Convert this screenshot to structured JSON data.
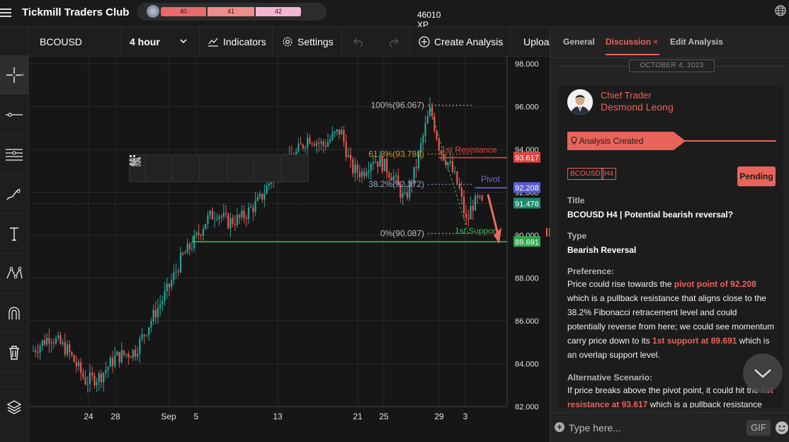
{
  "app": {
    "title": "Tickmill Traders Club",
    "xp_segments": [
      "40",
      "41",
      "42"
    ],
    "xp_value": "46010 XP"
  },
  "chart_header": {
    "symbol": "BCOUSD",
    "interval": "4 hour",
    "indicators_label": "Indicators",
    "settings_label": "Settings",
    "create_label": "Create Analysis",
    "upload_label": "Upload"
  },
  "chart_data": {
    "type": "candlestick",
    "symbol": "BCOUSD",
    "y_ticks": [
      "98.000",
      "96.000",
      "94.000",
      "92.000",
      "90.000",
      "88.000",
      "86.000",
      "84.000",
      "82.000"
    ],
    "ylim": [
      82.0,
      98.0
    ],
    "x_ticks": [
      "24",
      "28",
      "Sep",
      "5",
      "13",
      "21",
      "25",
      "29",
      "3"
    ],
    "fib_levels": [
      {
        "label": "100%(96.067)",
        "value": 96.067
      },
      {
        "label": "61.8%(93.788)",
        "value": 93.788
      },
      {
        "label": "38.2%(92.372)",
        "value": 92.372
      },
      {
        "label": "0%(90.087)",
        "value": 90.087
      }
    ],
    "lines": [
      {
        "label": "1st Resistance",
        "value": 93.617,
        "color": "#e0443f"
      },
      {
        "label": "Pivot",
        "value": 92.208,
        "color": "#6a6ae6"
      },
      {
        "label": "1st Support",
        "value": 89.691,
        "color": "#3dbb4e"
      }
    ],
    "price_badges": [
      {
        "text": "93.617",
        "color": "#e0443f"
      },
      {
        "text": "92.208",
        "color": "#5a5ad6"
      },
      {
        "text": "91.476",
        "color": "#1f8a70"
      },
      {
        "text": "89.691",
        "color": "#2fa84a"
      }
    ],
    "current_price": 91.476
  },
  "panel": {
    "tabs": [
      "General",
      "Discussion",
      "Edit Analysis"
    ],
    "tab_close": "×",
    "date": "OCTOBER 4, 2023",
    "author_role": "Chief Trader",
    "author_name": "Desmond Leong",
    "ribbon": "Analysis Created",
    "tags": [
      "BCOUSD",
      "H4"
    ],
    "status": "Pending",
    "title_label": "Title",
    "title_value": "BCOUSD H4 | Potential bearish reversal?",
    "type_label": "Type",
    "type_value": "Bearish Reversal",
    "preference_label": "Preference:",
    "pref_1": "Price could rise towards the ",
    "pref_hl1": "pivot point of 92.208",
    "pref_2": " which is a pullback resistance that aligns close to the 38.2% Fibonacci retracement level and could potentially reverse from here; we could see momentum carry price down to its ",
    "pref_hl2": "1st support at 89.691",
    "pref_3": " which is an overlap support level.",
    "alt_label": "Alternative Scenario:",
    "alt_1": "If price breaks above the pivot point, it could hit the ",
    "alt_hl1": "1st resistance at 93.617",
    "alt_2": " which is a pullback resistance",
    "composer_placeholder": "Type here...",
    "gif_label": "GIF"
  }
}
